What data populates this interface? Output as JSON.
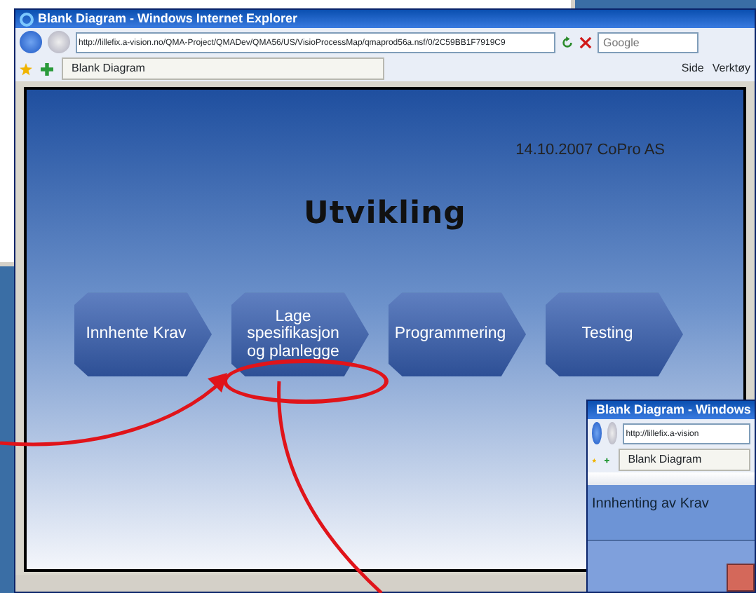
{
  "main_window": {
    "title": "Blank Diagram - Windows Internet Explorer",
    "address": "http://lillefix.a-vision.no/QMA-Project/QMADev/QMA56/US/VisioProcessMap/qmaprod56a.nsf/0/2C59BB1F7919C9",
    "search": {
      "placeholder": "Google"
    },
    "tab": "Blank Diagram",
    "toolbar": [
      "Side",
      "Verktøy"
    ]
  },
  "diagram": {
    "date_company": "14.10.2007 CoPro AS",
    "title": "Utvikling",
    "steps": [
      {
        "label": "Innhente Krav",
        "circled": false
      },
      {
        "label": "Lage spesifikasjon og planlegge",
        "circled": true
      },
      {
        "label": "Programmering",
        "circled": false
      },
      {
        "label": "Testing",
        "circled": false
      }
    ]
  },
  "second_window": {
    "title": "Blank Diagram - Windows",
    "address": "http://lillefix.a-vision",
    "tab": "Blank Diagram",
    "band": "Innhenting av Krav"
  }
}
